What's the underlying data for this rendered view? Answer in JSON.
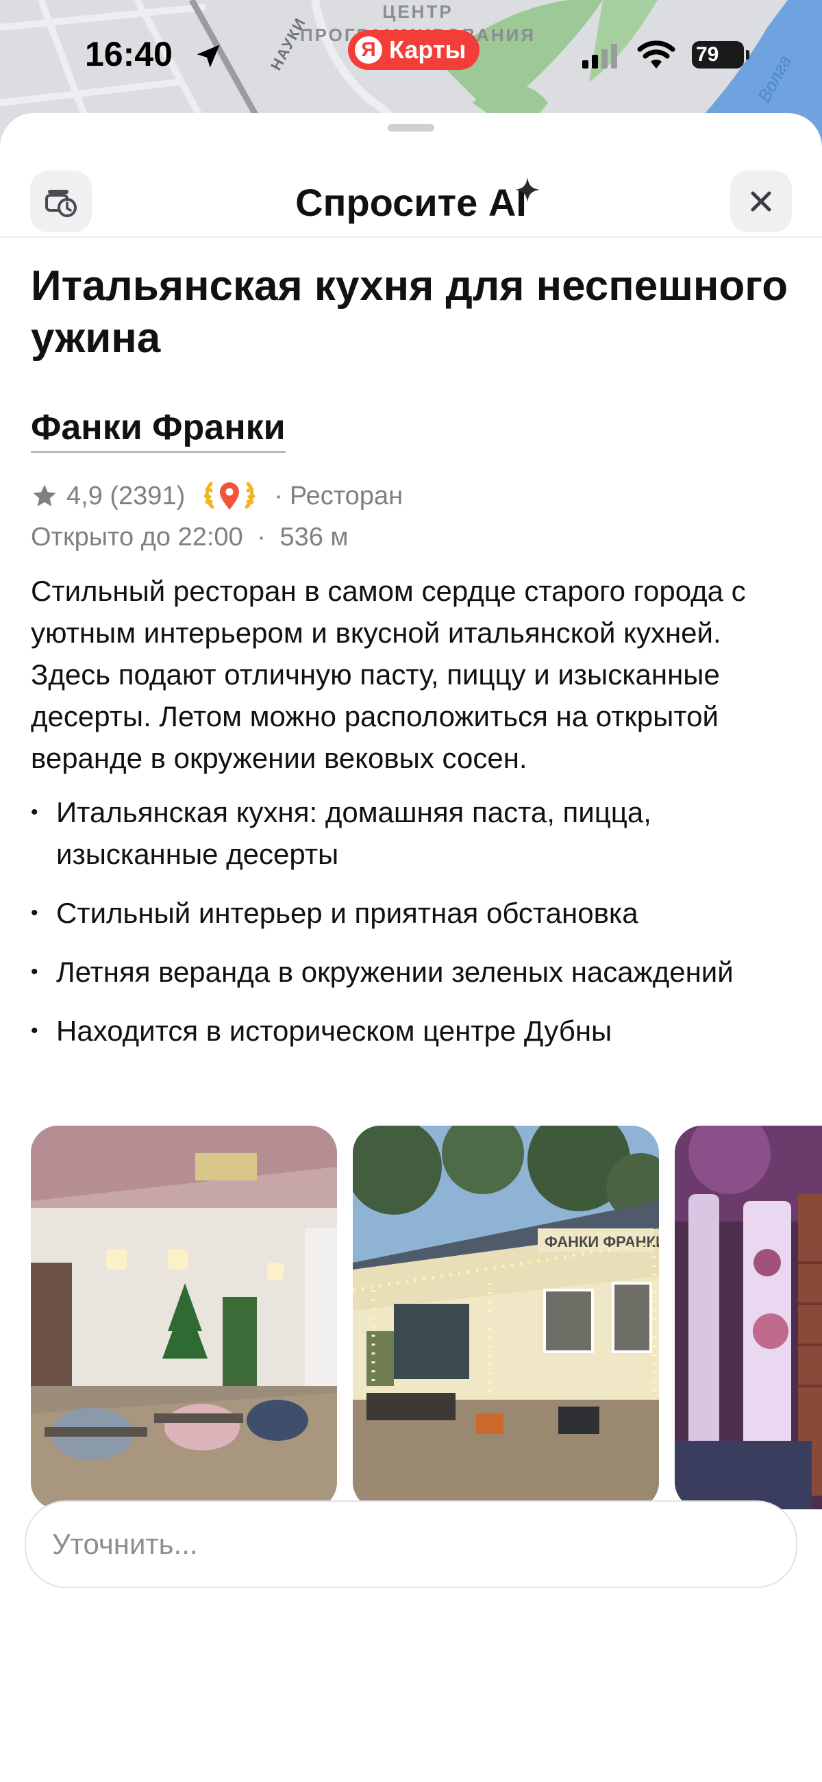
{
  "status_bar": {
    "time": "16:40",
    "app_name": "Карты",
    "app_logo_letter": "Я",
    "battery": "79"
  },
  "map": {
    "center_label_top": "ЦЕНТР",
    "center_label": "ПРОГРАММИРОВАНИЯ",
    "street_label": "НАУКИ",
    "river_label": "Волга"
  },
  "sheet": {
    "title": "Спросите AI",
    "history_icon": "history-icon",
    "close_icon": "close-icon"
  },
  "result": {
    "headline": "Итальянская кухня для неспешного ужина",
    "place_name": "Фанки Франки",
    "rating": "4,9 (2391)",
    "category": "Ресторан",
    "hours": "Открыто до 22:00",
    "distance": "536 м",
    "description": "Стильный ресторан в самом сердце старого города с уютным интерьером и вкусной итальянской кухней. Здесь подают отличную пасту, пиццу и изысканные десерты. Летом можно расположиться на открытой веранде в окружении вековых сосен.",
    "bullets": [
      "Итальянская кухня: домашняя паста, пицца, изысканные десерты",
      "Стильный интерьер и приятная обстановка",
      "Летняя веранда в окружении зеленых насаждений",
      "Находится в историческом центре Дубны"
    ],
    "photo_sign": "ФАНКИ ФРАНКИ"
  },
  "input": {
    "placeholder": "Уточнить..."
  },
  "colors": {
    "brand_red": "#f33d38",
    "award_gold": "#f2b51d",
    "muted_text": "#7e8085"
  }
}
